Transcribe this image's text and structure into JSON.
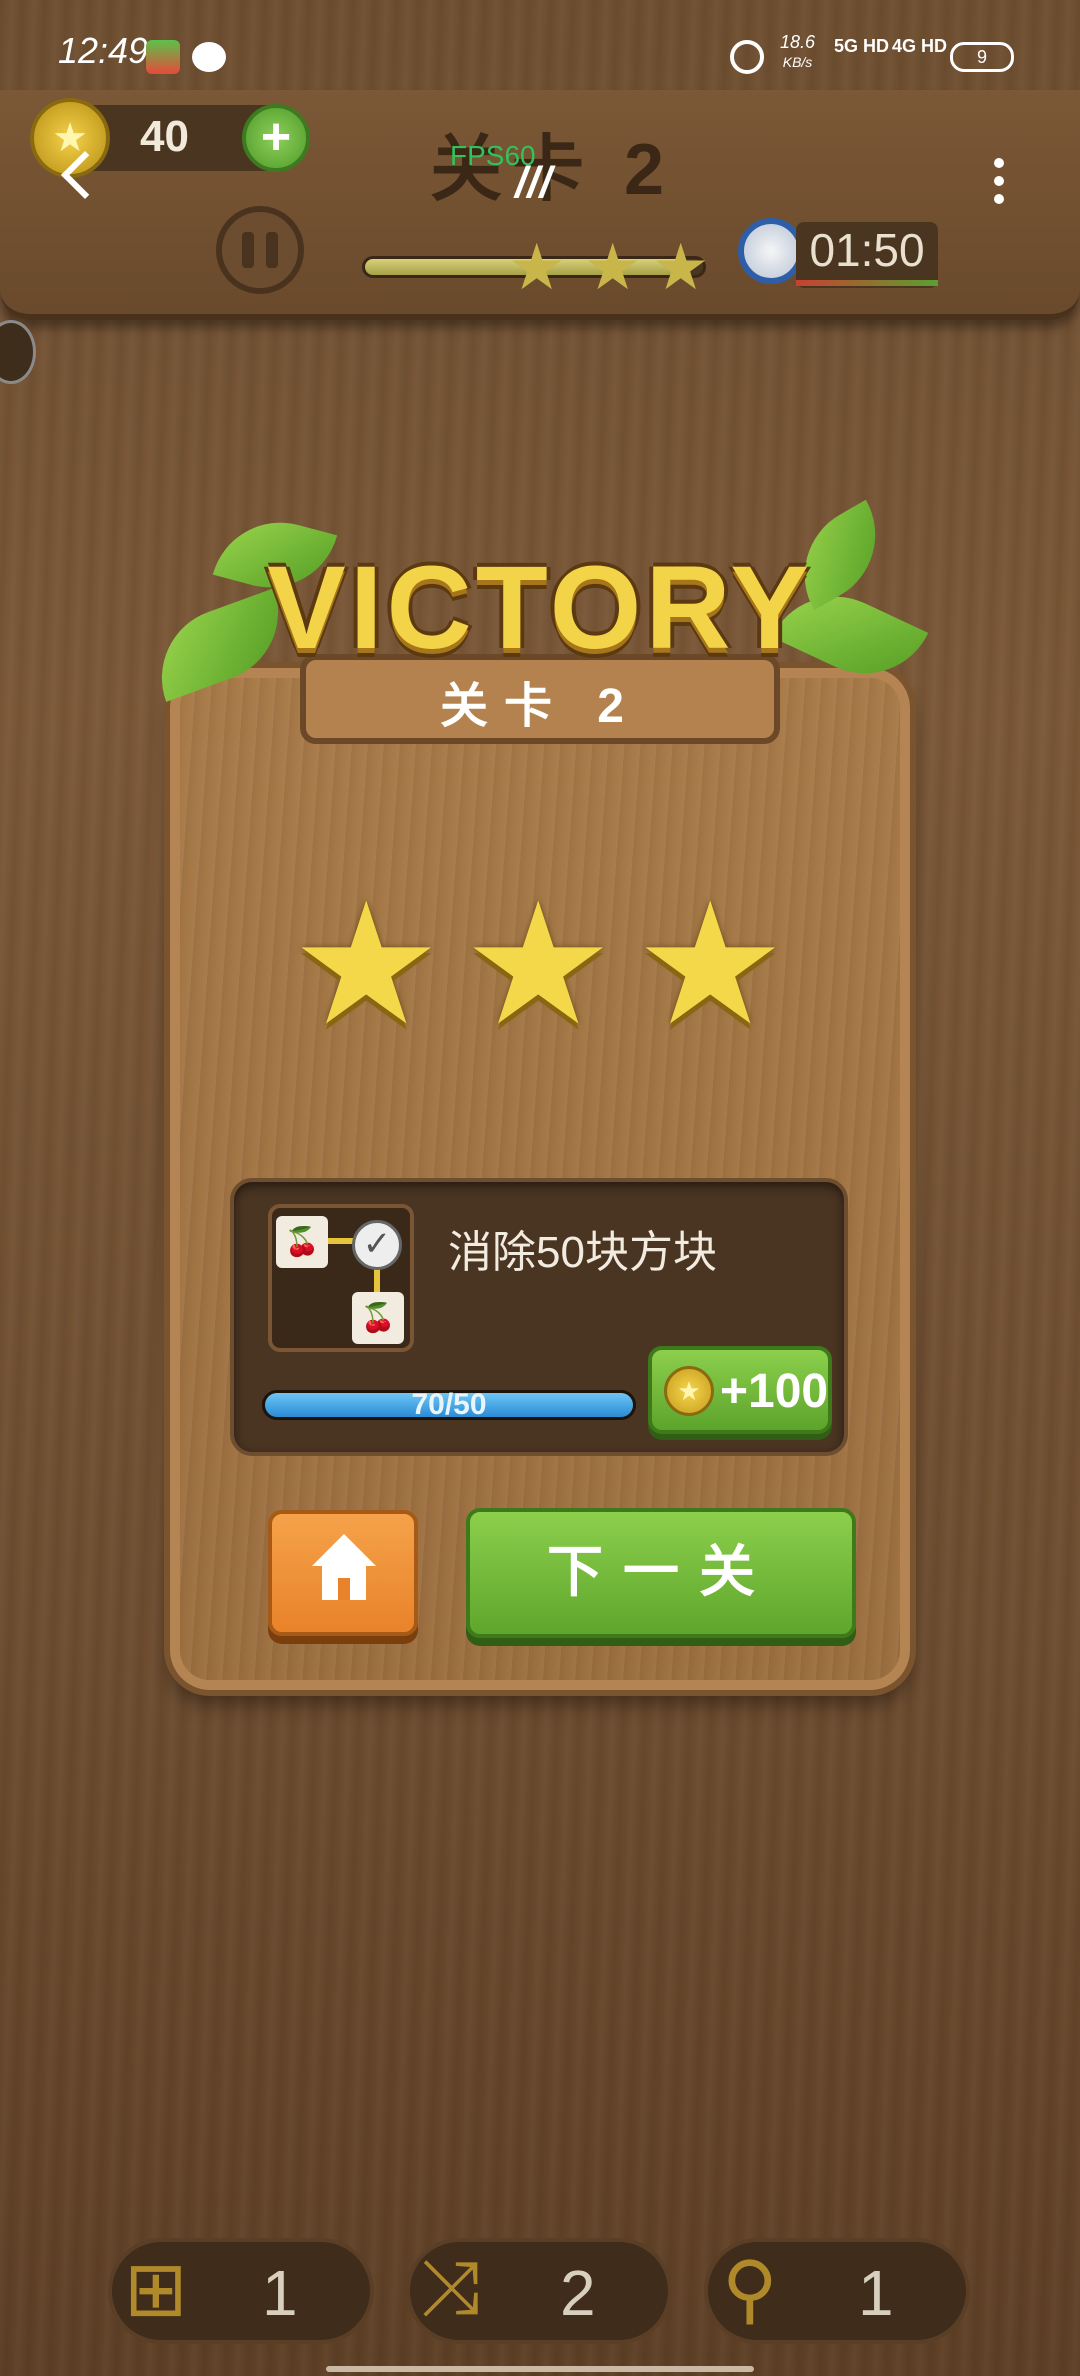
{
  "status_bar": {
    "time": "12:49",
    "net_speed": "18.6",
    "net_unit": "KB/s",
    "signal_1": "5G HD",
    "signal_2": "4G HD",
    "battery": "9"
  },
  "hud": {
    "coins": "40",
    "plus_label": "+",
    "level_title": "关卡 2",
    "fps": "FPS60",
    "handle": "///",
    "timer": "01:50",
    "star_progress": 0.95,
    "stars_earned": 3
  },
  "victory": {
    "title": "VICTORY",
    "level": "关卡 2",
    "stars": 3
  },
  "mission": {
    "text": "消除50块方块",
    "progress_text": "70/50",
    "progress": 1.0,
    "reward": "+100"
  },
  "buttons": {
    "next_label": "下一关"
  },
  "tools": [
    {
      "name": "hint",
      "icon": "hint-icon",
      "count": "1"
    },
    {
      "name": "shuffle",
      "icon": "shuffle-icon",
      "count": "2"
    },
    {
      "name": "search",
      "icon": "magnifier-icon",
      "count": "1"
    }
  ],
  "colors": {
    "wood": "#7a5737",
    "accent_green": "#6cb83a",
    "accent_orange": "#f0902f",
    "gold": "#f3d347",
    "bar_blue": "#2a8bd6"
  }
}
